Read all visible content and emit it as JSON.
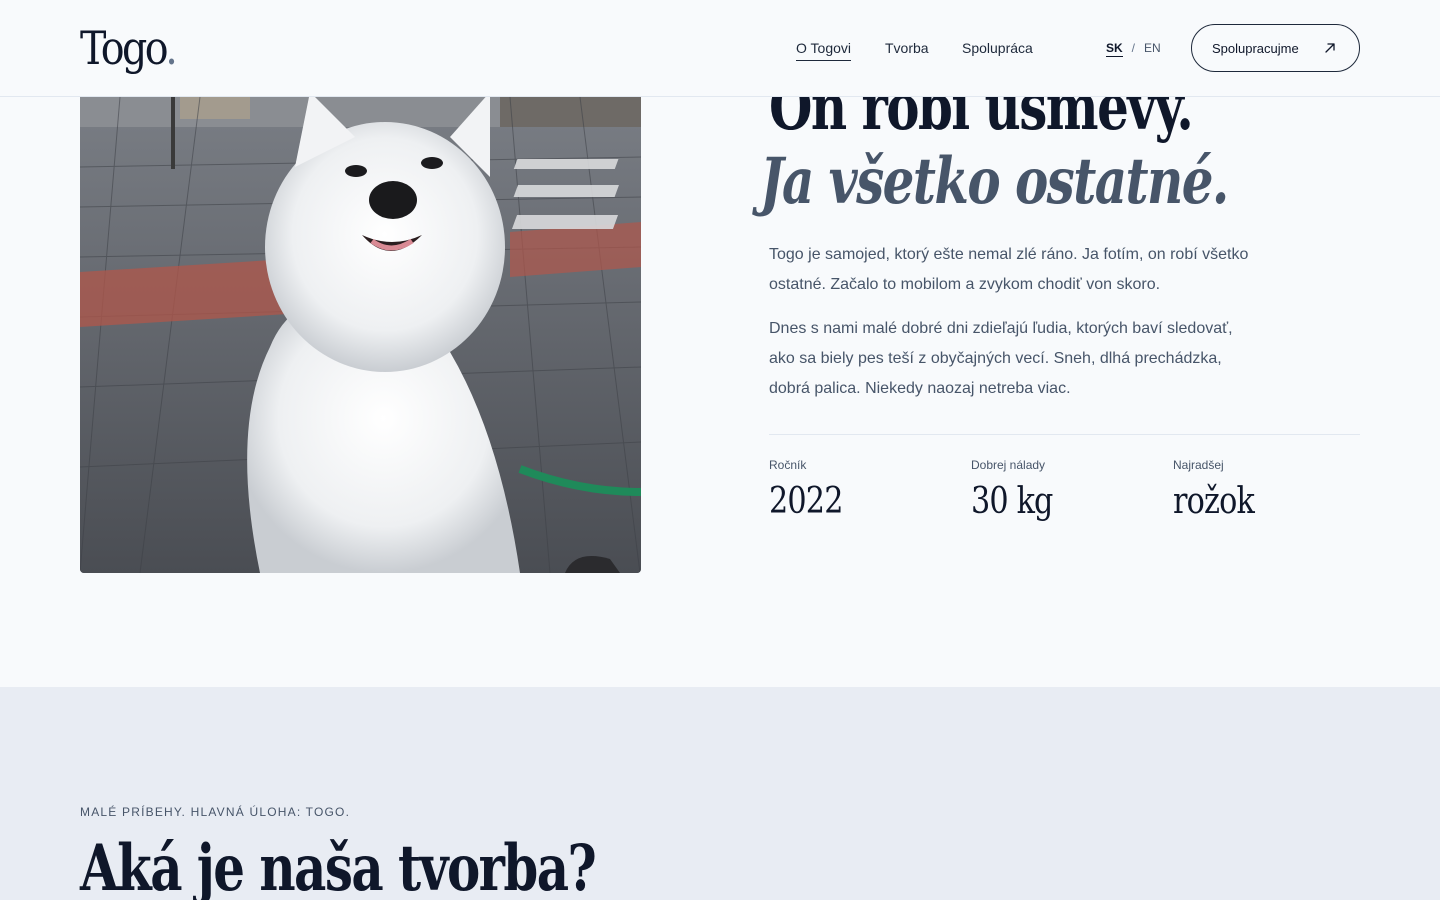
{
  "header": {
    "logo": "Togo",
    "logo_dot": ".",
    "nav": [
      {
        "label": "O Togovi",
        "active": true
      },
      {
        "label": "Tvorba",
        "active": false
      },
      {
        "label": "Spolupráca",
        "active": false
      }
    ],
    "lang": {
      "sk": "SK",
      "separator": "/",
      "en": "EN",
      "active": "SK"
    },
    "cta_label": "Spolupracujme",
    "cta_icon": "arrow-up-right-icon"
  },
  "hero": {
    "photo_alt": "Togo",
    "headline_line1": "On robí úsmevy.",
    "headline_line2": "Ja všetko ostatné.",
    "paragraph1": "Togo je samojed, ktorý ešte nemal zlé ráno. Ja fotím, on robí všetko ostatné. Začalo to mobilom a zvykom chodiť von skoro.",
    "paragraph2": "Dnes s nami malé dobré dni zdieľajú ľudia, ktorých baví sledovať, ako sa biely pes teší z obyčajných vecí. Sneh, dlhá prechádzka, dobrá palica. Niekedy naozaj netreba viac.",
    "stats": [
      {
        "label": "Ročník",
        "value": "2022"
      },
      {
        "label": "Dobrej nálady",
        "value": "30 kg"
      },
      {
        "label": "Najradšej",
        "value": "rožok"
      }
    ]
  },
  "creations": {
    "eyebrow": "MALÉ PRÍBEHY. HLAVNÁ ÚLOHA: TOGO.",
    "title": "Aká je naša tvorba?"
  },
  "colors": {
    "background": "#f8fafc",
    "section_background": "#e8ecf3",
    "text_primary": "#0f172a",
    "text_secondary": "#475569"
  }
}
